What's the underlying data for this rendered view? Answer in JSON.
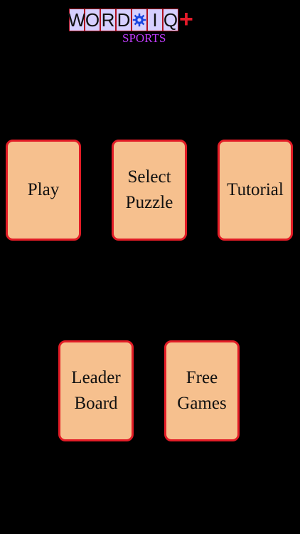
{
  "logo": {
    "letters": [
      "W",
      "O",
      "R",
      "D",
      "",
      "I",
      "Q"
    ],
    "plus": "+",
    "subtitle": "SPORTS",
    "gear_icon": "gear-icon"
  },
  "menu": {
    "play": "Play",
    "select_puzzle": "Select\nPuzzle",
    "tutorial": "Tutorial",
    "leader_board": "Leader\nBoard",
    "free_games": "Free\nGames"
  },
  "colors": {
    "background": "#000000",
    "card_fill": "#f6c08e",
    "card_border": "#e21c26",
    "tile_fill": "#d6d0ff",
    "subtitle": "#c23cff",
    "plus": "#e41b2a",
    "gear": "#1a46e0"
  }
}
